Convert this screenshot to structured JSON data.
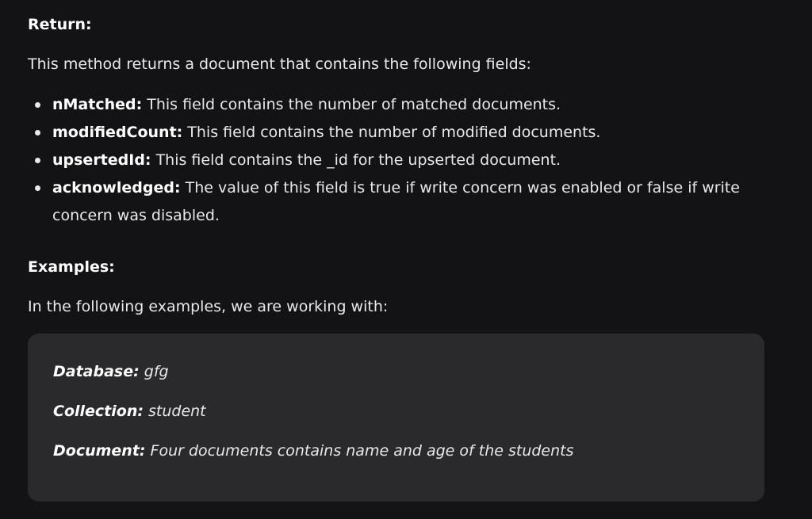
{
  "return_section": {
    "heading": "Return:",
    "intro": "This method returns a document that contains the following fields:",
    "fields": [
      {
        "name": "nMatched:",
        "desc": " This field contains the number of matched documents."
      },
      {
        "name": "modifiedCount:",
        "desc": " This field contains the number of modified documents."
      },
      {
        "name": "upsertedId:",
        "desc": " This field contains the _id for the upserted document."
      },
      {
        "name": "acknowledged:",
        "desc": " The value of this field is true if write concern was enabled or false if write concern was disabled."
      }
    ]
  },
  "examples_section": {
    "heading": "Examples:",
    "intro": "In the following examples, we are working with:",
    "box": {
      "database_label": "Database:",
      "database_value": " gfg",
      "collection_label": "Collection:",
      "collection_value": " student",
      "document_label": "Document:",
      "document_value": " Four documents contains name and age of the students"
    }
  },
  "colors": {
    "background": "#131316",
    "text": "#e9e9ea",
    "box_background": "#2a2a2d"
  }
}
